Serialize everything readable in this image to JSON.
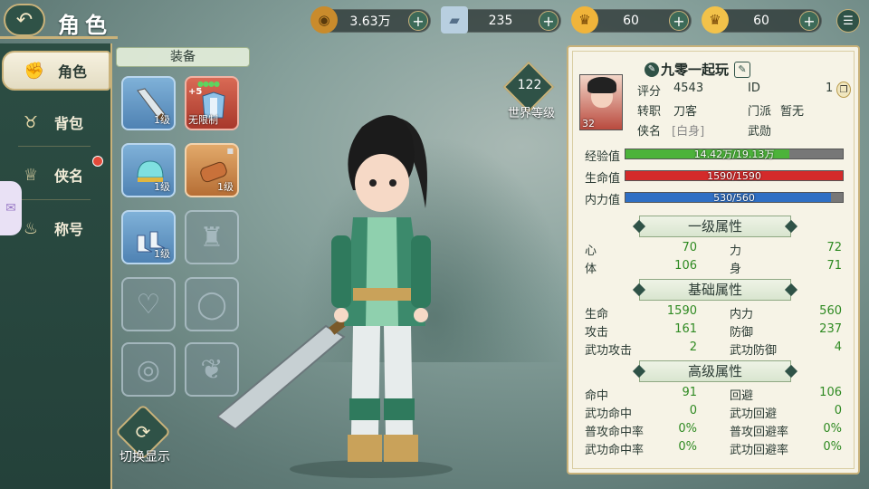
{
  "header": {
    "title": "角色"
  },
  "resources": [
    {
      "icon": "copper-coin-icon",
      "value": "3.63万"
    },
    {
      "icon": "silver-ingot-icon",
      "value": "235"
    },
    {
      "icon": "gold-ingot-icon",
      "value": "60"
    },
    {
      "icon": "yuanbao-icon",
      "value": "60"
    }
  ],
  "sidebar": {
    "items": [
      {
        "label": "角色",
        "icon": "character-icon",
        "active": true
      },
      {
        "label": "背包",
        "icon": "bag-icon"
      },
      {
        "label": "侠名",
        "icon": "fame-icon",
        "badge": true
      },
      {
        "label": "称号",
        "icon": "title-icon"
      }
    ]
  },
  "equipment": {
    "header": "装备",
    "slots": [
      {
        "level": "1级",
        "item": "sword"
      },
      {
        "plus": "+5",
        "tag": "无限制",
        "item": "armor"
      },
      {
        "level": "1级",
        "item": "helmet"
      },
      {
        "level": "1级",
        "item": "bracer"
      },
      {
        "level": "1级",
        "item": "boots"
      }
    ],
    "switch_label": "切换显示"
  },
  "world_level": {
    "value": "122",
    "label": "世界等级"
  },
  "profile": {
    "name": "九零一起玩",
    "avatar_level": "32",
    "score_label": "评分",
    "score": "4543",
    "id_label": "ID",
    "id": "1",
    "job_label": "转职",
    "job": "刀客",
    "sect_label": "门派",
    "sect": "暂无",
    "xia_label": "侠名",
    "xia": "[白身]",
    "skill": "武勋"
  },
  "bars": [
    {
      "label": "经验值",
      "text": "14.42万/19.13万",
      "fill": 0.754,
      "color": "#4cb33a"
    },
    {
      "label": "生命值",
      "text": "1590/1590",
      "fill": 1.0,
      "color": "#d42a2a"
    },
    {
      "label": "内力值",
      "text": "530/560",
      "fill": 0.946,
      "color": "#2f6fc4"
    }
  ],
  "sections": [
    {
      "title": "一级属性",
      "rows": [
        {
          "k1": "心",
          "v1": "70",
          "k2": "力",
          "v2": "72"
        },
        {
          "k1": "体",
          "v1": "106",
          "k2": "身",
          "v2": "71"
        }
      ]
    },
    {
      "title": "基础属性",
      "rows": [
        {
          "k1": "生命",
          "v1": "1590",
          "k2": "内力",
          "v2": "560"
        },
        {
          "k1": "攻击",
          "v1": "161",
          "k2": "防御",
          "v2": "237"
        },
        {
          "k1": "武功攻击",
          "v1": "2",
          "k2": "武功防御",
          "v2": "4"
        }
      ]
    },
    {
      "title": "高级属性",
      "rows": [
        {
          "k1": "命中",
          "v1": "91",
          "k2": "回避",
          "v2": "106"
        },
        {
          "k1": "武功命中",
          "v1": "0",
          "k2": "武功回避",
          "v2": "0"
        },
        {
          "k1": "普攻命中率",
          "v1": "0%",
          "k2": "普攻回避率",
          "v2": "0%"
        },
        {
          "k1": "武功命中率",
          "v1": "0%",
          "k2": "武功回避率",
          "v2": "0%"
        }
      ]
    }
  ]
}
